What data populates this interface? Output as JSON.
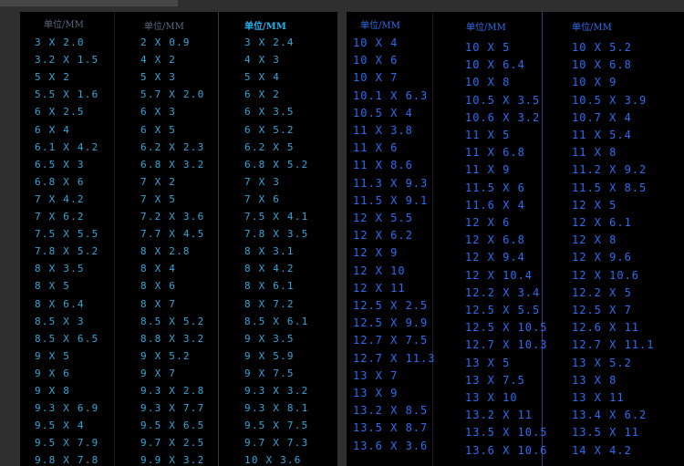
{
  "colors": {
    "left_text": "#33a6d9",
    "right_text": "#2d6cf2",
    "header_dim": "#5b6a82",
    "header_bright": "#1fb4f0",
    "header_right": "#2f6df0"
  },
  "left_table": {
    "headers": [
      "单位/MM",
      "单位/MM",
      "单位/MM"
    ],
    "columns": [
      [
        "3 X 2.0",
        "3.2 X 1.5",
        "5 X 2",
        "5.5 X 1.6",
        "6 X 2.5",
        "6 X 4",
        "6.1 X 4.2",
        "6.5 X 3",
        "6.8 X 6",
        "7 X 4.2",
        "7 X 6.2",
        "7.5 X 5.5",
        "7.8 X 5.2",
        "8 X 3.5",
        "8 X 5",
        "8 X 6.4",
        "8.5 X 3",
        "8.5 X 6.5",
        "9 X 5",
        "9 X 6",
        "9 X 8",
        "9.3 X 6.9",
        "9.5 X 4",
        "9.5 X 7.9",
        "9.8 X 7.8"
      ],
      [
        "2 X 0.9",
        "4 X 2",
        "5 X 3",
        "5.7 X 2.0",
        "6 X 3",
        "6 X 5",
        "6.2 X 2.3",
        "6.8 X 3.2",
        "7 X 2",
        "7 X 5",
        "7.2 X 3.6",
        "7.7 X 4.5",
        "8 X 2.8",
        "8 X 4",
        "8 X 6",
        "8 X 7",
        "8.5 X 5.2",
        "8.8 X 3.2",
        "9 X 5.2",
        "9 X 7",
        "9.3 X 2.8",
        "9.3 X 7.7",
        "9.5 X 6.5",
        "9.7 X 2.5",
        "9.9 X 3.2"
      ],
      [
        "3 X 2.4",
        "4 X 3",
        "5 X 4",
        "6 X 2",
        "6 X 3.5",
        "6 X 5.2",
        "6.2 X 5",
        "6.8 X 5.2",
        "7 X 3",
        "7 X 6",
        "7.5 X 4.1",
        "7.8 X 3.5",
        "8 X 3.1",
        "8 X 4.2",
        "8 X 6.1",
        "8 X 7.2",
        "8.5 X 6.1",
        "9 X 3.5",
        "9 X 5.9",
        "9 X 7.5",
        "9.3 X 3.2",
        "9.3 X 8.1",
        "9.5 X 7.5",
        "9.7 X 7.3",
        "10 X 3.6"
      ]
    ]
  },
  "right_table": {
    "headers": [
      "单位/MM",
      "单位/MM",
      "单位/MM"
    ],
    "columns": [
      [
        "10 X 4",
        "10 X 6",
        "10 X 7",
        "10.1 X 6.3",
        "10.5 X 4",
        "11 X 3.8",
        "11 X 6",
        "11 X 8.6",
        "11.3 X 9.3",
        "11.5 X 9.1",
        "12 X 5.5",
        "12 X 6.2",
        "12 X 9",
        "12 X 10",
        "12 X 11",
        "12.5 X 2.5",
        "12.5 X 9.9",
        "12.7 X 7.5",
        "12.7 X 11.3",
        "13 X 7",
        "13 X 9",
        "13.2 X 8.5",
        "13.5 X 8.7",
        "13.6 X 3.6"
      ],
      [
        "10 X 5",
        "10 X 6.4",
        "10 X 8",
        "10.5 X 3.5",
        "10.6 X 3.2",
        "11 X 5",
        "11 X 6.8",
        "11 X 9",
        "11.5 X 6",
        "11.6 X 4",
        "12 X 6",
        "12 X 6.8",
        "12 X 9.4",
        "12 X 10.4",
        "12.2 X 3.4",
        "12.5 X 5.5",
        "12.5 X 10.5",
        "12.7 X 10.3",
        "13 X 5",
        "13 X 7.5",
        "13 X 10",
        "13.2 X 11",
        "13.5 X 10.5",
        "13.6 X 10.6"
      ],
      [
        "10 X 5.2",
        "10 X 6.8",
        "10 X 9",
        "10.5 X 3.9",
        "10.7 X 4",
        "11 X 5.4",
        "11 X 8",
        "11.2 X 9.2",
        "11.5 X 8.5",
        "12 X 5",
        "12 X 6.1",
        "12 X 8",
        "12 X 9.6",
        "12 X 10.6",
        "12.2 X 5",
        "12.5 X 7",
        "12.6 X 11",
        "12.7 X 11.1",
        "13 X 5.2",
        "13 X 8",
        "13 X 11",
        "13.4 X 6.2",
        "13.5 X 11",
        "14 X 4.2"
      ]
    ]
  }
}
